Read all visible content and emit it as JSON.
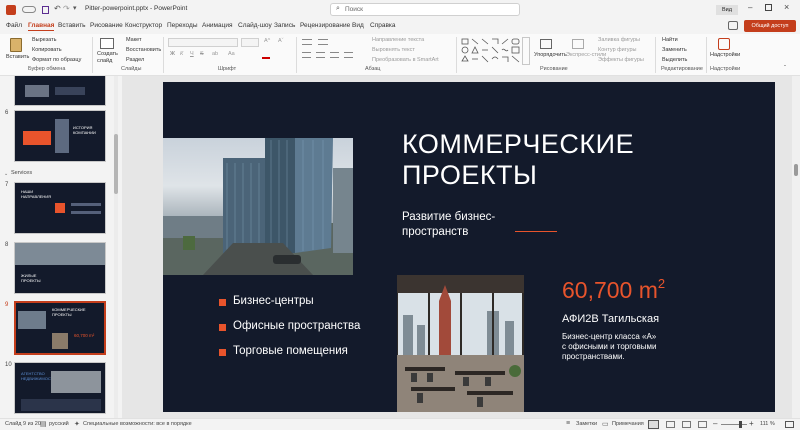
{
  "titlebar": {
    "filename": "Pitter-powerpoint.pptx",
    "app": "PowerPoint",
    "separator": "-",
    "search_placeholder": "Поиск",
    "view_btn": "Вид"
  },
  "menu": {
    "items": [
      "Файл",
      "Главная",
      "Вставить",
      "Рисование",
      "Конструктор",
      "Переходы",
      "Анимация",
      "Слайд-шоу",
      "Запись",
      "Рецензирование",
      "Вид",
      "Справка"
    ],
    "active": "Главная",
    "share": "Общий доступ"
  },
  "ribbon": {
    "clipboard": {
      "paste": "Вставить",
      "cut": "Вырезать",
      "copy": "Копировать",
      "format": "Формат по образцу",
      "label": "Буфер обмена"
    },
    "slides": {
      "new_slide": "Создать слайд",
      "layout": "Макет",
      "reset": "Восстановить",
      "section": "Раздел",
      "label": "Слайды"
    },
    "font": {
      "label": "Шрифт",
      "bold": "Ж",
      "italic": "К",
      "underline": "Ч",
      "strike": "S"
    },
    "paragraph": {
      "text_dir": "Направление текста",
      "align_text": "Выровнять текст",
      "smartart": "Преобразовать в SmartArt",
      "label": "Абзац"
    },
    "drawing": {
      "arrange": "Упорядочить",
      "quick_styles": "Экспресс-стили",
      "fill": "Заливка фигуры",
      "outline": "Контур фигуры",
      "effects": "Эффекты фигуры",
      "label": "Рисование"
    },
    "editing": {
      "find": "Найти",
      "replace": "Заменить",
      "select": "Выделить",
      "label": "Редактирование"
    },
    "addins": {
      "btn": "Надстройки",
      "label": "Надстройки"
    }
  },
  "thumbnails": {
    "section_label": "Services",
    "slides": [
      {
        "num": "6",
        "title": "ИСТОРИЯ КОМПАНИИ"
      },
      {
        "num": "7",
        "title": "НАШИ НАПРАВЛЕНИЯ"
      },
      {
        "num": "8",
        "title": "ЖИЛЫЕ ПРОЕКТЫ"
      },
      {
        "num": "9",
        "title": "КОММЕРЧЕСКИЕ ПРОЕКТЫ",
        "stat": "60,700 m²"
      },
      {
        "num": "10",
        "title": "АГЕНТСТВО НЕДВИЖИМОСТИ"
      }
    ]
  },
  "slide": {
    "title_line1": "КОММЕРЧЕСКИЕ",
    "title_line2": "ПРОЕКТЫ",
    "subtitle_line1": "Развитие бизнес-",
    "subtitle_line2": "пространств",
    "bullets": [
      "Бизнес-центры",
      "Офисные пространства",
      "Торговые помещения"
    ],
    "stat_value": "60,700 m",
    "stat_sup": "2",
    "stat_name": "АФИ2В Тагильская",
    "stat_desc_l1": "Бизнес-центр класса «А»",
    "stat_desc_l2": "с офисными и торговыми",
    "stat_desc_l3": "пространствами."
  },
  "status": {
    "slide_of": "Слайд 9 из 20",
    "language": "русский",
    "accessibility": "Специальные возможности: все в порядке",
    "notes": "Заметки",
    "comments": "Примечания",
    "zoom": "111 %"
  },
  "colors": {
    "accent": "#e8542c",
    "slide_bg": "#131a2b",
    "ppt_red": "#c43e1c"
  }
}
